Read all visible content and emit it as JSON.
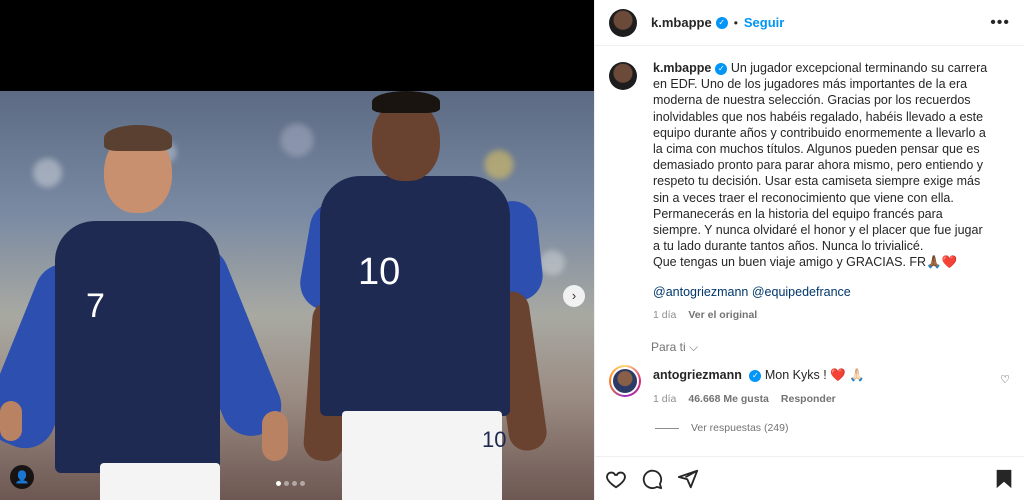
{
  "post": {
    "author": "k.mbappe",
    "follow_label": "Seguir",
    "more_label": "•••",
    "separator": "•"
  },
  "media": {
    "jersey_numbers": [
      "7",
      "10",
      "10"
    ],
    "slide_count": 4,
    "active_slide": 1,
    "next_label": "›",
    "tag_label": "👤"
  },
  "caption": {
    "username": "k.mbappe",
    "text": " Un jugador excepcional terminando su carrera en EDF. Uno de los jugadores más importantes de la era moderna de nuestra selección. Gracias por los recuerdos inolvidables que nos habéis regalado, habéis llevado a este equipo durante años y contribuido enormemente a llevarlo a la cima con muchos títulos. Algunos pueden pensar que es demasiado pronto para parar ahora mismo, pero entiendo y respeto tu decisión. Usar esta camiseta siempre exige más sin a veces traer el reconocimiento que viene con ella. Permanecerás en la historia del equipo francés para siempre. Y nunca olvidaré el honor y el placer que fue jugar a tu lado durante tantos años. Nunca lo trivialicé.\nQue tengas un buen viaje amigo y GRACIAS. FR🙏🏾❤️",
    "tags": "@antogriezmann @equipedefrance",
    "time": "1 día",
    "see_original": "Ver el original"
  },
  "for_you_label": "Para ti ⌵",
  "comment": {
    "username": "antogriezmann",
    "text": "Mon Kyks ! ",
    "emoji": "❤️ 🙏🏻",
    "time": "1 día",
    "likes": "46.668 Me gusta",
    "reply_label": "Responder",
    "like_icon": "♡"
  },
  "replies_label": "Ver respuestas (249)",
  "colors": {
    "accent": "#0095f6",
    "link": "#00376b",
    "muted": "#8e8e8e"
  }
}
